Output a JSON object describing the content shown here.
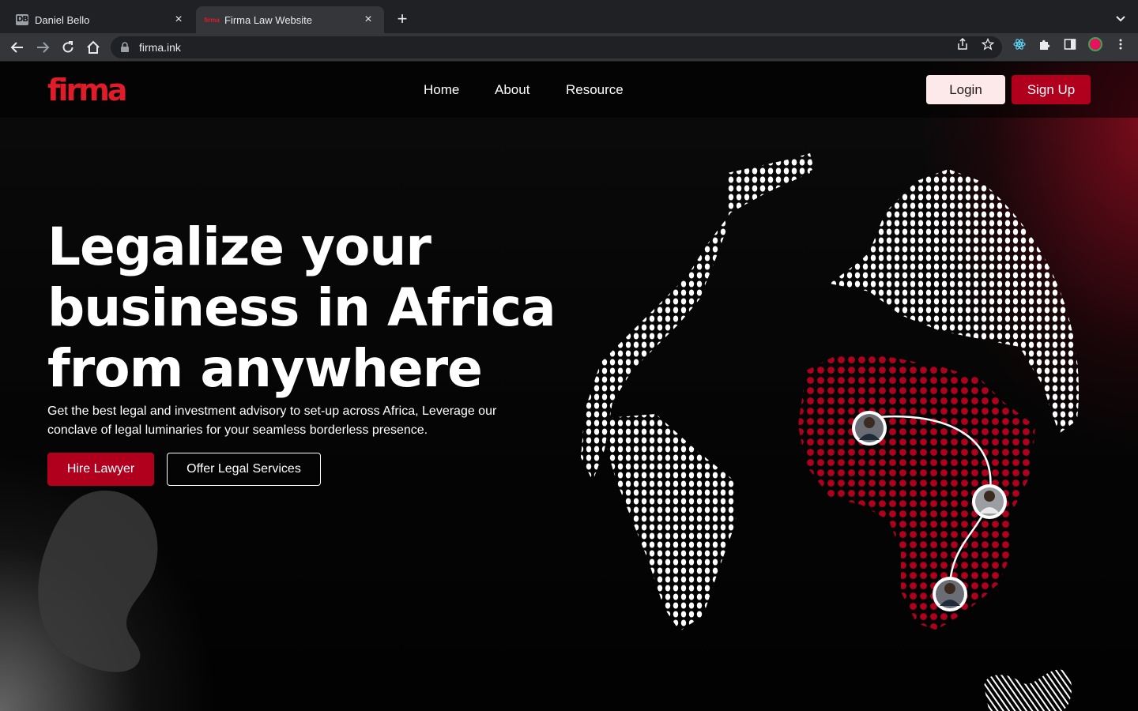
{
  "browser": {
    "tabs": [
      {
        "title": "Daniel Bello",
        "favicon": "DB",
        "active": false
      },
      {
        "title": "Firma Law Website",
        "favicon": "firma",
        "active": true
      }
    ],
    "url": "firma.ink"
  },
  "site": {
    "logo": "firma",
    "nav": [
      "Home",
      "About",
      "Resource"
    ],
    "login_label": "Login",
    "signup_label": "Sign Up",
    "headline": [
      "Legalize your",
      "business in Africa",
      "from anywhere"
    ],
    "subtext": "Get the best legal and investment advisory to set-up across Africa, Leverage our conclave of legal luminaries for your seamless borderless presence.",
    "hire_label": "Hire Lawyer",
    "offer_label": "Offer Legal Services"
  },
  "colors": {
    "brand_red": "#b0001e",
    "logo_red": "#e01b2a",
    "login_bg": "#fde8ea",
    "background": "#000000"
  }
}
